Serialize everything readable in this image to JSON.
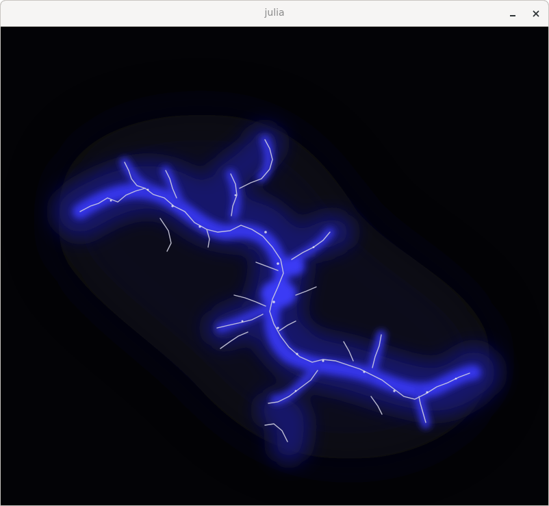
{
  "window": {
    "title": "julia"
  },
  "titlebar_buttons": [
    {
      "name": "minimize",
      "icon": "minimize-icon"
    },
    {
      "name": "close",
      "icon": "close-icon"
    }
  ],
  "fractal": {
    "type": "julia-set",
    "palette": {
      "background": "#030306",
      "glow_outer": "#0b0b25",
      "glow_mid": "#1a1a70",
      "core": "#3a3af0",
      "filament": "#d8d8e0"
    }
  }
}
